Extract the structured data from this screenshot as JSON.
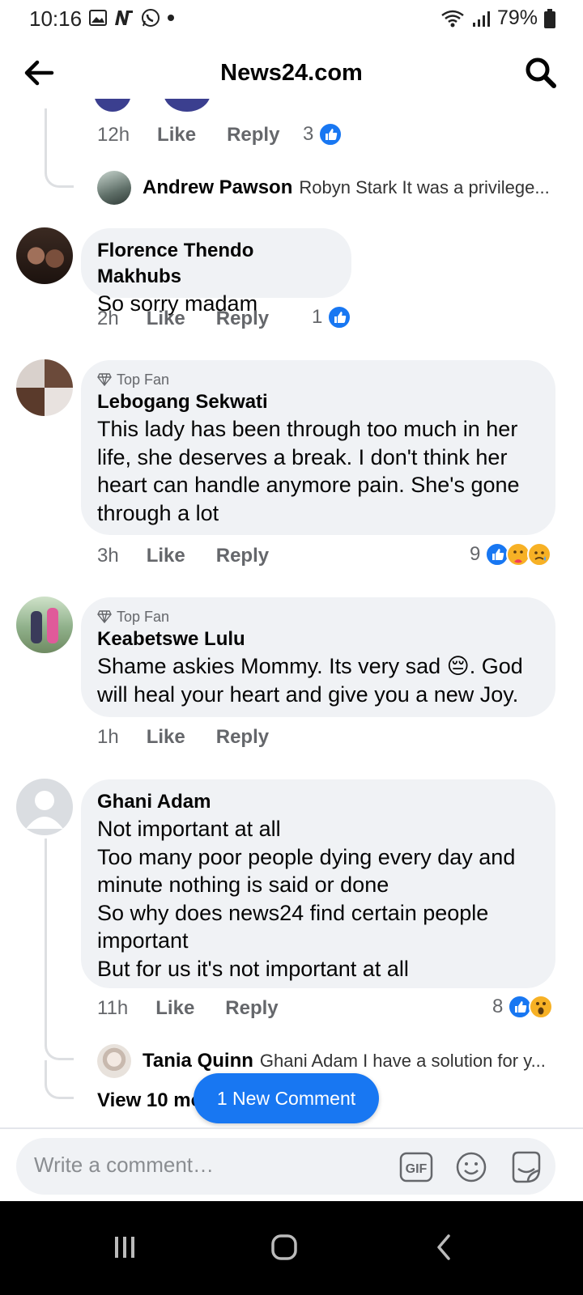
{
  "status_bar": {
    "time": "10:16",
    "battery": "79%"
  },
  "header": {
    "title": "News24.com"
  },
  "partial_comment": {
    "time": "12h",
    "like": "Like",
    "reply": "Reply",
    "reaction_count": "3",
    "reply_preview": {
      "name": "Andrew Pawson",
      "text": "Robyn Stark It was a privilege..."
    }
  },
  "comments": [
    {
      "author": "Florence Thendo Makhubs",
      "text": "So sorry madam",
      "time": "2h",
      "like": "Like",
      "reply": "Reply",
      "reaction_count": "1"
    },
    {
      "badge": "Top Fan",
      "author": "Lebogang Sekwati",
      "lines": [
        "This lady has been through too much in her",
        "life, she deserves a break. I don't think her",
        "heart can handle anymore pain. She's gone",
        "through a lot"
      ],
      "time": "3h",
      "like": "Like",
      "reply": "Reply",
      "reaction_count": "9"
    },
    {
      "badge": "Top Fan",
      "author": "Keabetswe Lulu",
      "lines": [
        "Shame askies Mommy. Its very sad 😔. God",
        "will heal your heart and give you a new Joy."
      ],
      "time": "1h",
      "like": "Like",
      "reply": "Reply"
    },
    {
      "author": "Ghani Adam",
      "lines": [
        "Not important at all",
        "Too many poor people dying every day and",
        "minute nothing is said or done",
        "So why does news24 find certain people",
        "important",
        "But for us it's not important at all"
      ],
      "time": "11h",
      "like": "Like",
      "reply": "Reply",
      "reaction_count": "8",
      "reply_preview": {
        "name": "Tania Quinn",
        "text": "Ghani Adam  I have a solution for y..."
      },
      "view_more": "View 10 more"
    }
  ],
  "new_comment_pill": "1 New Comment",
  "composer": {
    "placeholder": "Write a comment…"
  },
  "colors": {
    "accent": "#1877f2",
    "bubble": "#f0f2f5",
    "secondary_text": "#65676b"
  }
}
